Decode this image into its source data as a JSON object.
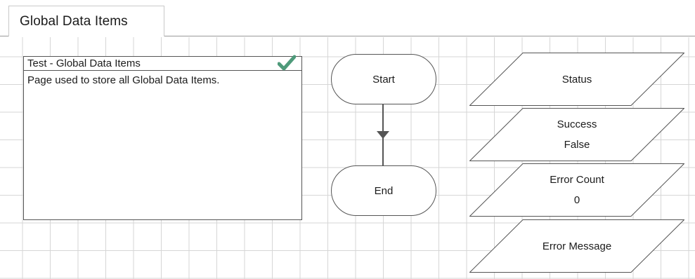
{
  "tab": {
    "label": "Global Data Items"
  },
  "page_info": {
    "title": "Test - Global Data Items",
    "description": "Page used to store all Global Data Items.",
    "status_icon": "check-icon",
    "status_color": "#4e9a7a"
  },
  "flow": {
    "start_label": "Start",
    "end_label": "End"
  },
  "data_items": [
    {
      "name": "Status",
      "value": ""
    },
    {
      "name": "Success",
      "value": "False"
    },
    {
      "name": "Error Count",
      "value": "0"
    },
    {
      "name": "Error Message",
      "value": ""
    }
  ]
}
